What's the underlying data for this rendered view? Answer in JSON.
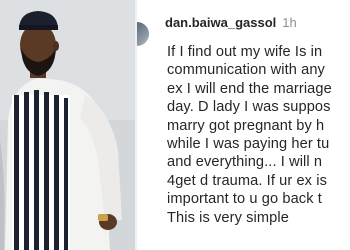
{
  "photo": {
    "subject": "man-in-striped-agbada-portrait"
  },
  "comment": {
    "username": "dan.baiwa_gassol",
    "timestamp": "1h",
    "lines": [
      "If I find out my wife Is in",
      "communication with any",
      "ex I will end the marriage",
      "day. D lady I was suppos",
      "marry got pregnant by h",
      "while I was paying her tu",
      "and everything... I will n",
      "4get d trauma.  If ur ex is",
      "important to u go back t",
      "This is very simple"
    ]
  },
  "colors": {
    "text": "#262626",
    "muted": "#8e8e8e",
    "background": "#ffffff"
  }
}
